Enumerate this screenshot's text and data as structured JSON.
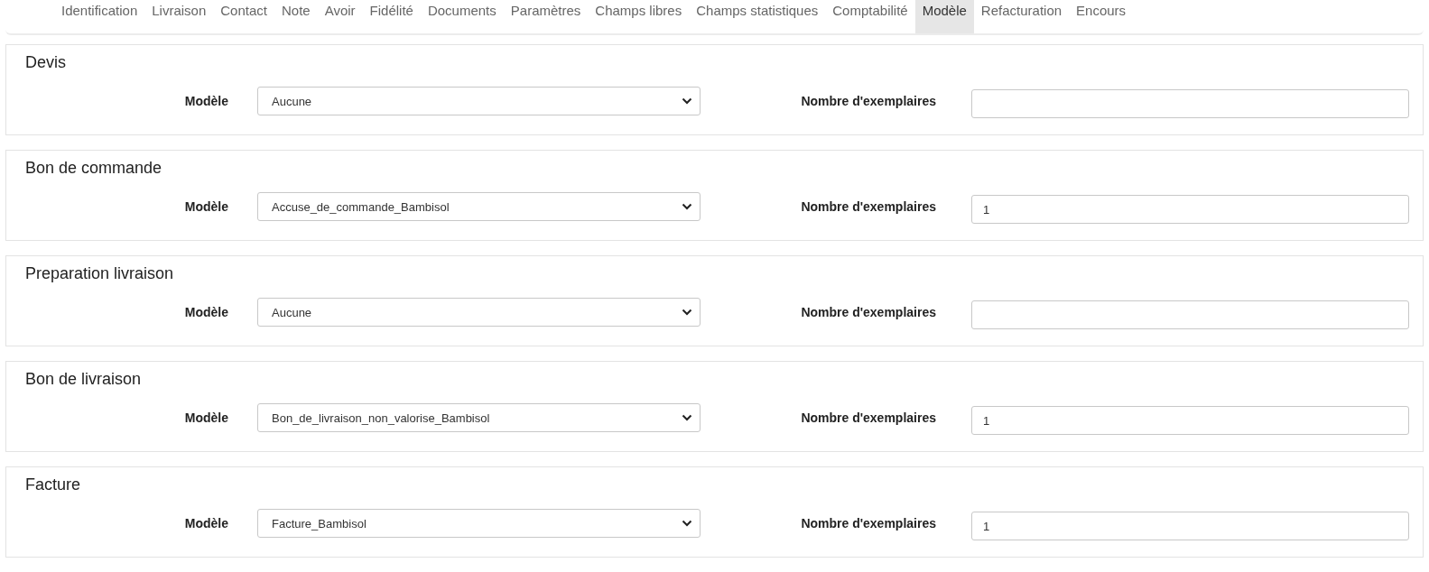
{
  "tabs": [
    {
      "label": "Identification",
      "selected": false
    },
    {
      "label": "Livraison",
      "selected": false
    },
    {
      "label": "Contact",
      "selected": false
    },
    {
      "label": "Note",
      "selected": false
    },
    {
      "label": "Avoir",
      "selected": false
    },
    {
      "label": "Fidélité",
      "selected": false
    },
    {
      "label": "Documents",
      "selected": false
    },
    {
      "label": "Paramètres",
      "selected": false
    },
    {
      "label": "Champs libres",
      "selected": false
    },
    {
      "label": "Champs statistiques",
      "selected": false
    },
    {
      "label": "Comptabilité",
      "selected": false
    },
    {
      "label": "Modèle",
      "selected": true
    },
    {
      "label": "Refacturation",
      "selected": false
    },
    {
      "label": "Encours",
      "selected": false
    }
  ],
  "sections": [
    {
      "title": "Devis",
      "model_label": "Modèle",
      "model_value": "Aucune",
      "copies_label": "Nombre d'exemplaires"
    },
    {
      "title": "Bon de commande",
      "model_label": "Modèle",
      "model_value": "Accuse_de_commande_Bambisol",
      "copies_label": "Nombre d'exemplaires",
      "copies_value": "1"
    },
    {
      "title": "Preparation livraison",
      "model_label": "Modèle",
      "model_value": "Aucune",
      "copies_label": "Nombre d'exemplaires"
    },
    {
      "title": "Bon de livraison",
      "model_label": "Modèle",
      "model_value": "Bon_de_livraison_non_valorise_Bambisol",
      "copies_label": "Nombre d'exemplaires",
      "copies_value": "1"
    },
    {
      "title": "Facture",
      "model_label": "Modèle",
      "model_value": "Facture_Bambisol",
      "copies_label": "Nombre d'exemplaires",
      "copies_value": "1"
    }
  ]
}
